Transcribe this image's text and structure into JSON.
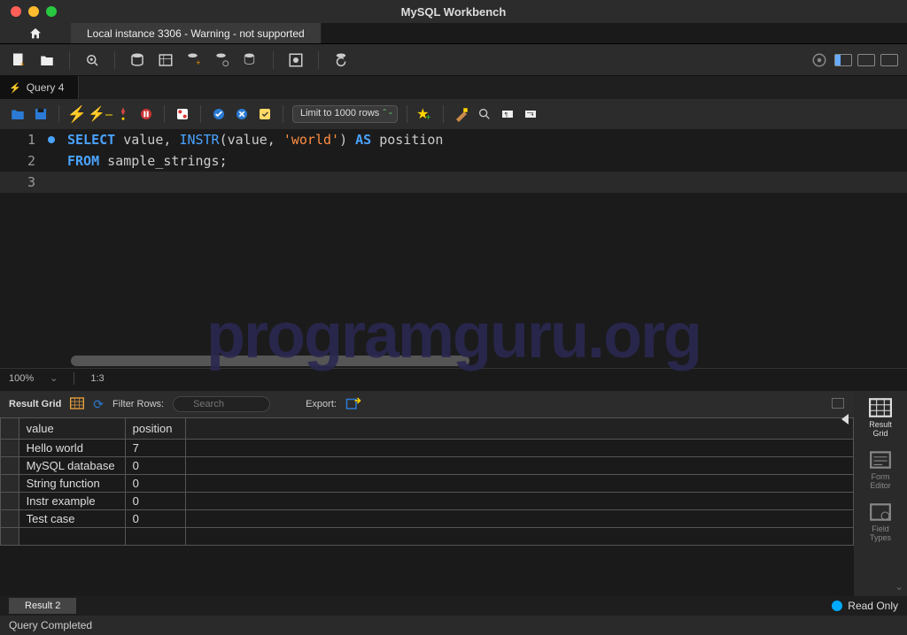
{
  "window": {
    "title": "MySQL Workbench"
  },
  "connection_tab": "Local instance 3306 - Warning - not supported",
  "query_tab": "Query 4",
  "limit_select": "Limit to 1000 rows",
  "editor": {
    "lines": [
      {
        "n": "1",
        "html": "<span class='kw'>SELECT</span> <span class='id'>value</span>, <span class='fn'>INSTR</span>(<span class='id'>value</span>, <span class='str'>'world'</span>) <span class='kw'>AS</span> <span class='id'>position</span>"
      },
      {
        "n": "2",
        "html": "<span class='kw'>FROM</span> <span class='id'>sample_strings</span>;"
      },
      {
        "n": "3",
        "html": ""
      }
    ]
  },
  "edit_status": {
    "zoom": "100%",
    "pos": "1:3"
  },
  "results": {
    "label": "Result Grid",
    "filter_label": "Filter Rows:",
    "filter_placeholder": "Search",
    "export_label": "Export:",
    "columns": [
      "value",
      "position"
    ],
    "rows": [
      [
        "Hello world",
        "7"
      ],
      [
        "MySQL database",
        "0"
      ],
      [
        "String function",
        "0"
      ],
      [
        "Instr example",
        "0"
      ],
      [
        "Test case",
        "0"
      ]
    ]
  },
  "side_tabs": {
    "result_grid": "Result\nGrid",
    "form_editor": "Form\nEditor",
    "field_types": "Field\nTypes"
  },
  "result_tab": "Result 2",
  "readonly": "Read Only",
  "status": "Query Completed",
  "watermark": "programguru.org"
}
